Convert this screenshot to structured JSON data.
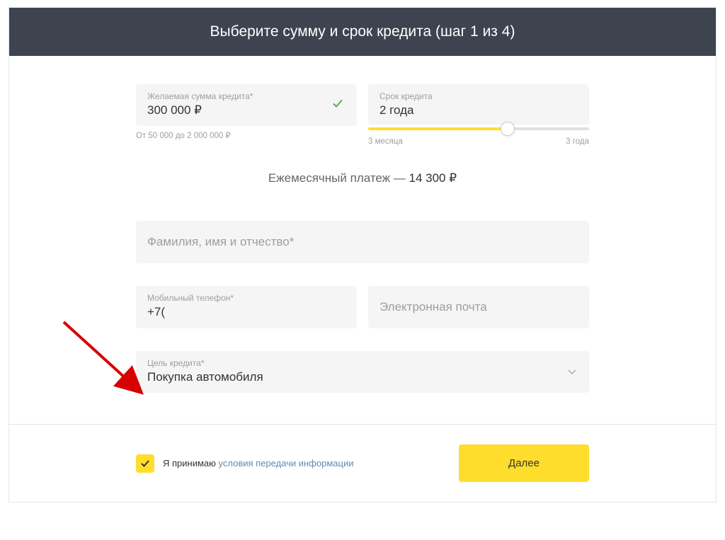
{
  "header": {
    "title": "Выберите сумму и срок кредита (шаг 1 из 4)"
  },
  "amount": {
    "label": "Желаемая сумма кредита*",
    "value": "300 000 ₽",
    "hint": "От 50 000 до 2 000 000 ₽"
  },
  "term": {
    "label": "Срок кредита",
    "value": "2 года",
    "min_label": "3 месяца",
    "max_label": "3 года"
  },
  "payment": {
    "label": "Ежемесячный платеж — ",
    "value": "14 300 ₽"
  },
  "fullname": {
    "placeholder": "Фамилия, имя и отчество*"
  },
  "phone": {
    "label": "Мобильный телефон*",
    "value": "+7("
  },
  "email": {
    "placeholder": "Электронная почта"
  },
  "purpose": {
    "label": "Цель кредита*",
    "value": "Покупка автомобиля"
  },
  "consent": {
    "text_prefix": "Я принимаю ",
    "link_text": "условия передачи информации"
  },
  "buttons": {
    "next": "Далее"
  }
}
